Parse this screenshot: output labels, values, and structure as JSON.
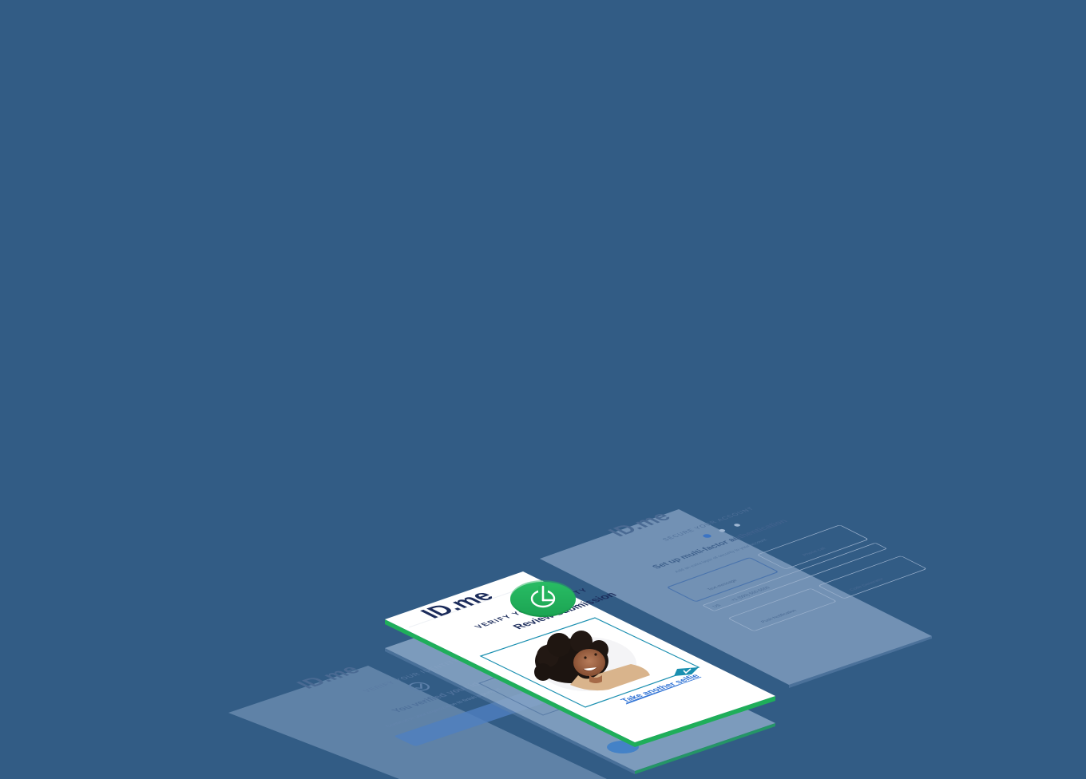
{
  "colors": {
    "background": "#325c85",
    "card_white": "#ffffff",
    "ghost_card": "#6f8fb3",
    "accent_green": "#1fae5a",
    "brand_navy": "#1b2b5a",
    "accent_blue": "#2a7fd4",
    "accent_teal": "#1a8fb0"
  },
  "front_card": {
    "logo_text": "ID.me",
    "eyebrow": "VERIFY YOUR IDENTITY",
    "heading": "Review submission",
    "retake_link": "Take another selfie"
  },
  "right_card": {
    "logo_text": "ID.me",
    "eyebrow": "SECURE YOUR ACCOUNT",
    "heading": "Set up multi-factor authentication",
    "body": "Add an extra layer of security to your account",
    "option_one": "Text message",
    "option_two": "Phone call",
    "option_three": "Code Generator",
    "option_four": "Push Notification",
    "phone_label": "US",
    "phone_value": "+1 (555) 555-5555"
  },
  "left_card": {
    "logo_text": "ID.me",
    "eyebrow": "VERIFY YOUR IDENTITY",
    "heading": "You verified your identity",
    "body": "Continue to your organization to finish signing in"
  },
  "badge": {
    "icon": "power-check-icon"
  }
}
